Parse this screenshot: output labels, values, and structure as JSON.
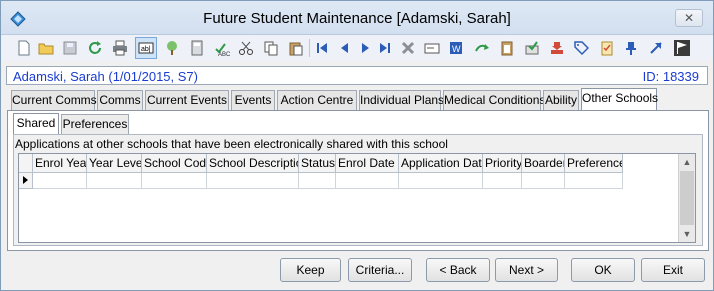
{
  "window": {
    "title": "Future Student Maintenance  [Adamski, Sarah]",
    "close_label": "✕"
  },
  "toolbar": {
    "buttons": [
      {
        "icon": "new-icon"
      },
      {
        "icon": "open-folder-icon"
      },
      {
        "icon": "save-icon"
      },
      {
        "icon": "refresh-icon"
      },
      {
        "icon": "print-icon"
      },
      {
        "icon": "text-field-icon"
      },
      {
        "icon": "tree-icon"
      },
      {
        "icon": "calculator-icon"
      },
      {
        "icon": "spellcheck-icon"
      },
      {
        "icon": "cut-icon"
      },
      {
        "icon": "copy-icon"
      },
      {
        "icon": "paste-icon"
      },
      {
        "icon": "first-record-icon"
      },
      {
        "icon": "previous-record-icon"
      },
      {
        "icon": "next-record-icon"
      },
      {
        "icon": "last-record-icon"
      },
      {
        "icon": "delete-icon"
      },
      {
        "icon": "card-icon"
      },
      {
        "icon": "word-icon"
      },
      {
        "icon": "forward-icon"
      },
      {
        "icon": "clipboard-icon"
      },
      {
        "icon": "approve-icon"
      },
      {
        "icon": "download-icon"
      },
      {
        "icon": "tag-icon"
      },
      {
        "icon": "checklist-icon"
      },
      {
        "icon": "pin-icon"
      },
      {
        "icon": "arrow-up-right-icon"
      },
      {
        "icon": "flag-icon"
      }
    ]
  },
  "student": {
    "name": "Adamski, Sarah (1/01/2015, S7)",
    "id": "ID: 18339"
  },
  "tabs": [
    {
      "label": "Current Comms"
    },
    {
      "label": "Comms"
    },
    {
      "label": "Current Events"
    },
    {
      "label": "Events"
    },
    {
      "label": "Action Centre"
    },
    {
      "label": "Individual Plans"
    },
    {
      "label": "Medical Conditions"
    },
    {
      "label": "Ability"
    },
    {
      "label": "Other Schools"
    }
  ],
  "subtabs": [
    {
      "label": "Shared"
    },
    {
      "label": "Preferences"
    }
  ],
  "group": {
    "label": "Applications at other schools that have been electronically shared with this school"
  },
  "grid": {
    "columns": [
      "Enrol Year",
      "Year Level",
      "School Code",
      "School Description",
      "Status",
      "Enrol Date",
      "Application Date",
      "Priority",
      "Boarder",
      "Preference"
    ],
    "rows": [
      [
        "",
        "",
        "",
        "",
        "",
        "",
        "",
        "",
        "",
        ""
      ]
    ]
  },
  "buttons": {
    "keep": "Keep",
    "criteria": "Criteria...",
    "back": "< Back",
    "next": "Next >",
    "ok": "OK",
    "exit": "Exit"
  },
  "colors": {
    "accent_blue": "#1a3ccf",
    "navigation_blue": "#2b5cb8"
  }
}
